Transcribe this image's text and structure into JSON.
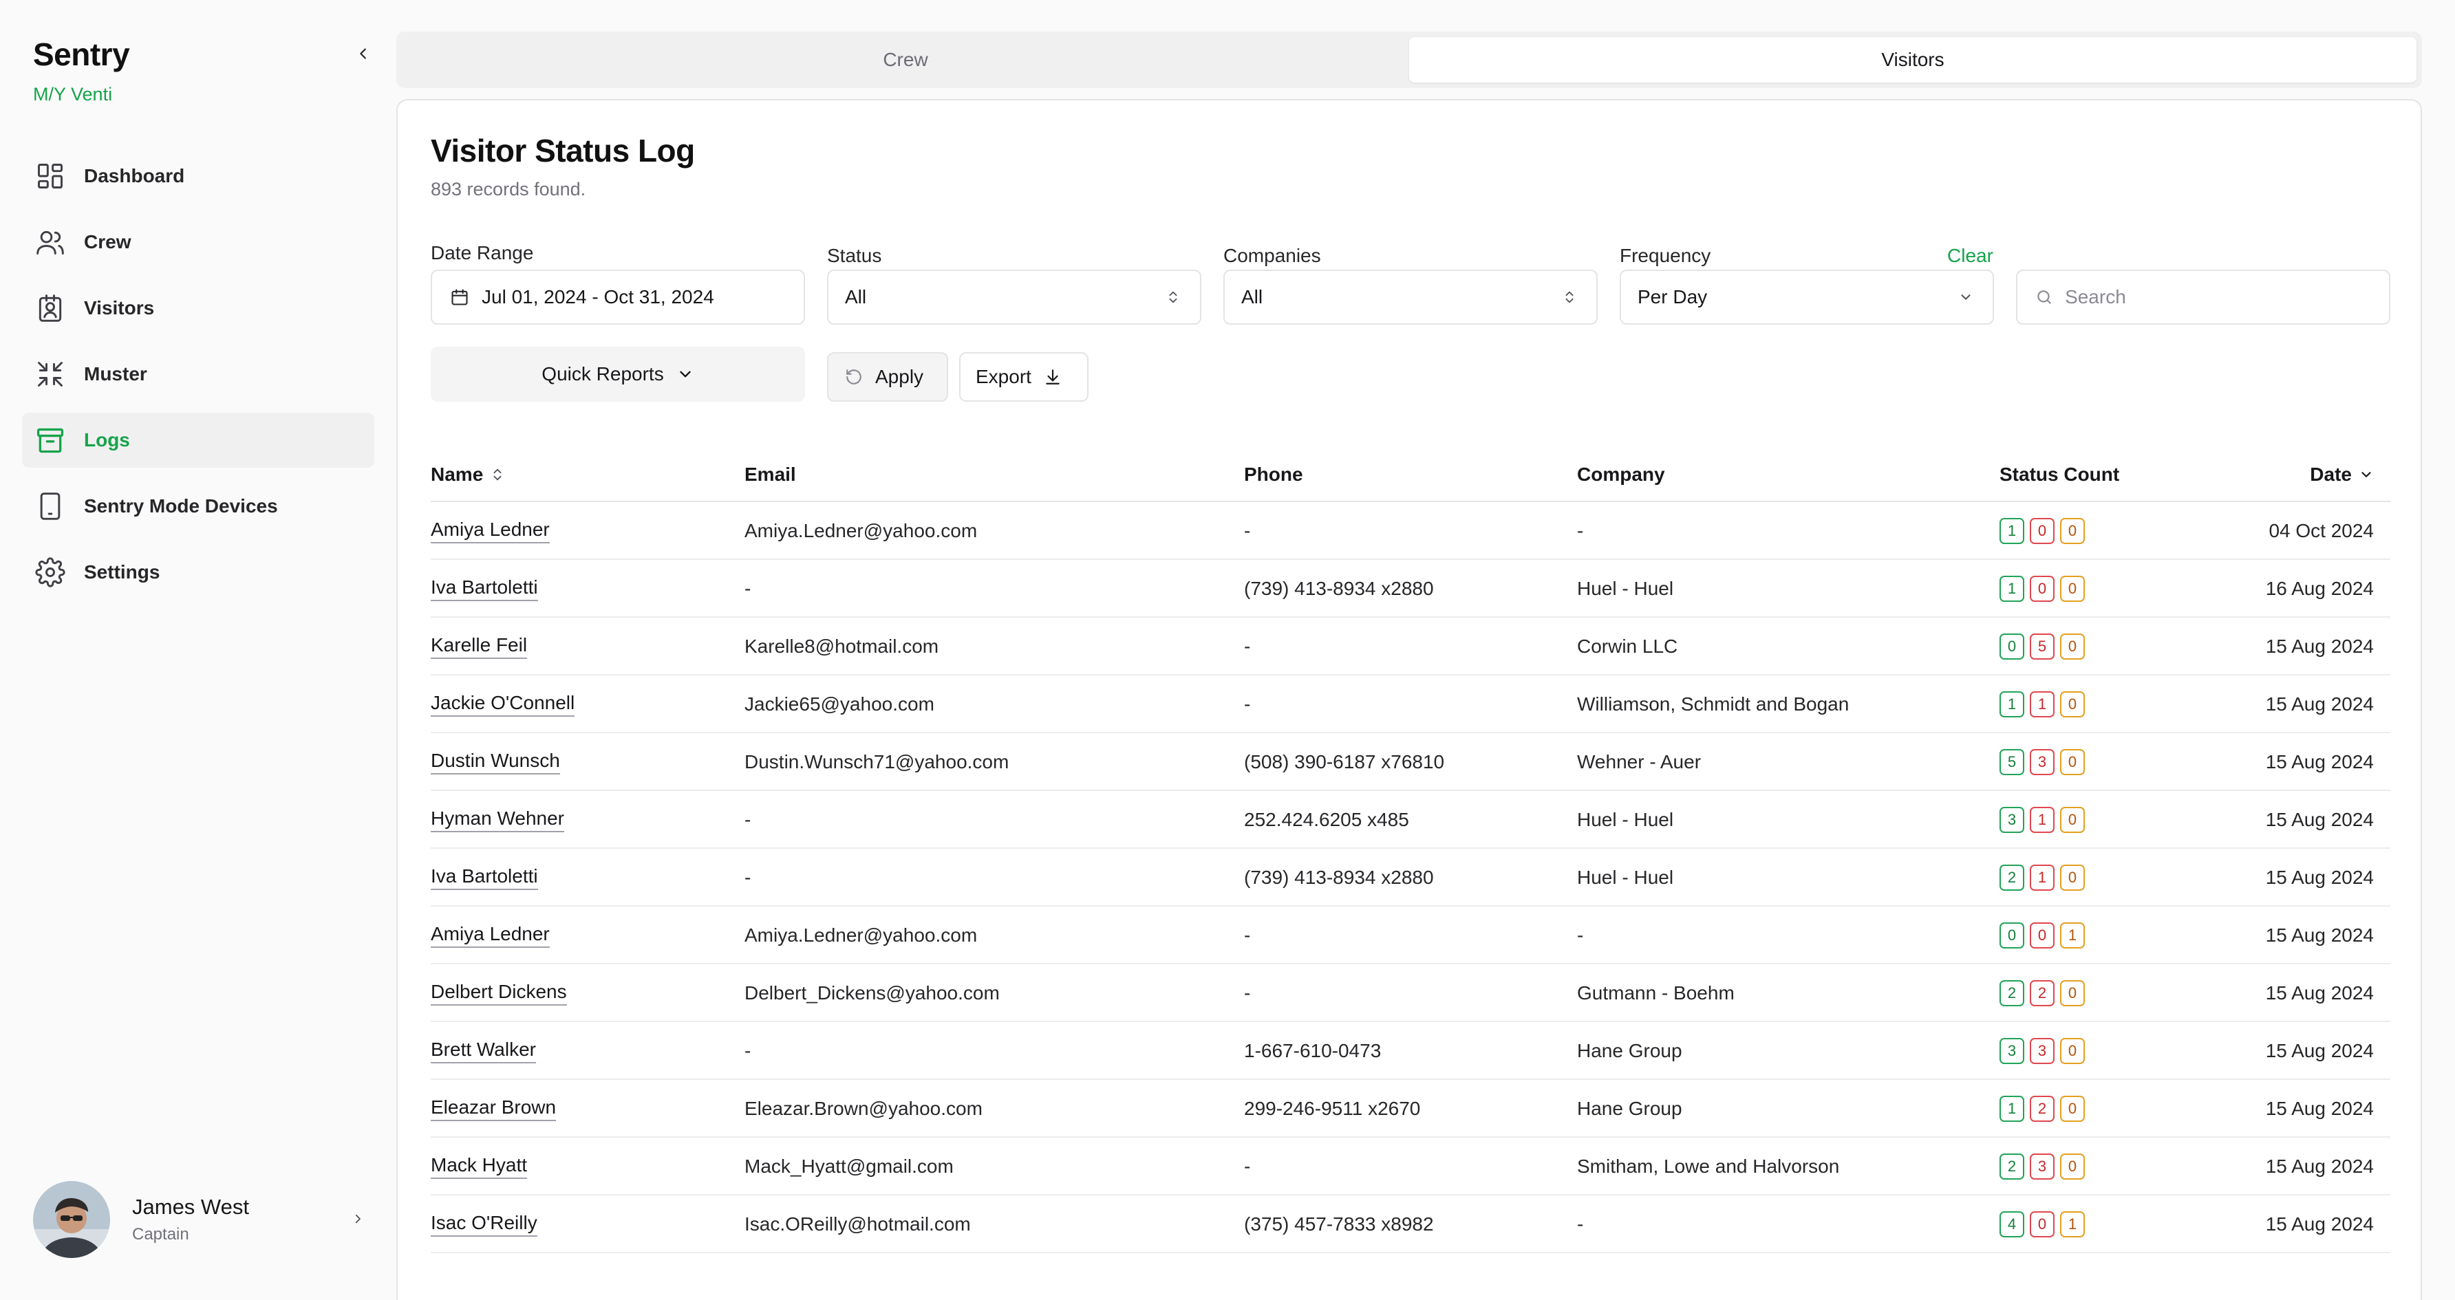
{
  "brand": {
    "title": "Sentry",
    "subtitle": "M/Y Venti"
  },
  "sidebar": {
    "items": [
      {
        "label": "Dashboard",
        "icon": "dashboard-icon"
      },
      {
        "label": "Crew",
        "icon": "users-icon"
      },
      {
        "label": "Visitors",
        "icon": "visitor-badge-icon"
      },
      {
        "label": "Muster",
        "icon": "muster-icon"
      },
      {
        "label": "Logs",
        "icon": "archive-icon",
        "active": true
      },
      {
        "label": "Sentry Mode Devices",
        "icon": "tablet-icon"
      },
      {
        "label": "Settings",
        "icon": "gear-icon"
      }
    ]
  },
  "user": {
    "name": "James West",
    "role": "Captain"
  },
  "tabs": [
    {
      "label": "Crew",
      "active": false
    },
    {
      "label": "Visitors",
      "active": true
    }
  ],
  "page": {
    "title": "Visitor Status Log",
    "subtitle": "893 records found."
  },
  "filters": {
    "date_range": {
      "label": "Date Range",
      "value": "Jul 01, 2024 - Oct 31, 2024"
    },
    "status": {
      "label": "Status",
      "value": "All"
    },
    "companies": {
      "label": "Companies",
      "value": "All"
    },
    "frequency": {
      "label": "Frequency",
      "value": "Per Day",
      "clear": "Clear"
    },
    "search": {
      "placeholder": "Search"
    }
  },
  "actions": {
    "quick_reports": "Quick Reports",
    "apply": "Apply",
    "export": "Export"
  },
  "table": {
    "columns": [
      "Name",
      "Email",
      "Phone",
      "Company",
      "Status Count",
      "Date"
    ],
    "rows": [
      {
        "name": "Amiya Ledner",
        "email": "Amiya.Ledner@yahoo.com",
        "phone": "-",
        "company": "-",
        "counts": [
          1,
          0,
          0
        ],
        "date": "04 Oct 2024"
      },
      {
        "name": "Iva Bartoletti",
        "email": "-",
        "phone": "(739) 413-8934 x2880",
        "company": "Huel - Huel",
        "counts": [
          1,
          0,
          0
        ],
        "date": "16 Aug 2024"
      },
      {
        "name": "Karelle Feil",
        "email": "Karelle8@hotmail.com",
        "phone": "-",
        "company": "Corwin LLC",
        "counts": [
          0,
          5,
          0
        ],
        "date": "15 Aug 2024"
      },
      {
        "name": "Jackie O'Connell",
        "email": "Jackie65@yahoo.com",
        "phone": "-",
        "company": "Williamson, Schmidt and Bogan",
        "counts": [
          1,
          1,
          0
        ],
        "date": "15 Aug 2024"
      },
      {
        "name": "Dustin Wunsch",
        "email": "Dustin.Wunsch71@yahoo.com",
        "phone": "(508) 390-6187 x76810",
        "company": "Wehner - Auer",
        "counts": [
          5,
          3,
          0
        ],
        "date": "15 Aug 2024"
      },
      {
        "name": "Hyman Wehner",
        "email": "-",
        "phone": "252.424.6205 x485",
        "company": "Huel - Huel",
        "counts": [
          3,
          1,
          0
        ],
        "date": "15 Aug 2024"
      },
      {
        "name": "Iva Bartoletti",
        "email": "-",
        "phone": "(739) 413-8934 x2880",
        "company": "Huel - Huel",
        "counts": [
          2,
          1,
          0
        ],
        "date": "15 Aug 2024"
      },
      {
        "name": "Amiya Ledner",
        "email": "Amiya.Ledner@yahoo.com",
        "phone": "-",
        "company": "-",
        "counts": [
          0,
          0,
          1
        ],
        "date": "15 Aug 2024"
      },
      {
        "name": "Delbert Dickens",
        "email": "Delbert_Dickens@yahoo.com",
        "phone": "-",
        "company": "Gutmann - Boehm",
        "counts": [
          2,
          2,
          0
        ],
        "date": "15 Aug 2024"
      },
      {
        "name": "Brett Walker",
        "email": "-",
        "phone": "1-667-610-0473",
        "company": "Hane Group",
        "counts": [
          3,
          3,
          0
        ],
        "date": "15 Aug 2024"
      },
      {
        "name": "Eleazar Brown",
        "email": "Eleazar.Brown@yahoo.com",
        "phone": "299-246-9511 x2670",
        "company": "Hane Group",
        "counts": [
          1,
          2,
          0
        ],
        "date": "15 Aug 2024"
      },
      {
        "name": "Mack Hyatt",
        "email": "Mack_Hyatt@gmail.com",
        "phone": "-",
        "company": "Smitham, Lowe and Halvorson",
        "counts": [
          2,
          3,
          0
        ],
        "date": "15 Aug 2024"
      },
      {
        "name": "Isac O'Reilly",
        "email": "Isac.OReilly@hotmail.com",
        "phone": "(375) 457-7833 x8982",
        "company": "-",
        "counts": [
          4,
          0,
          1
        ],
        "date": "15 Aug 2024"
      }
    ]
  },
  "colors": {
    "accent": "#16a34a",
    "badge_green": "#22a357",
    "badge_red": "#e0484f",
    "badge_orange": "#e3a020"
  }
}
